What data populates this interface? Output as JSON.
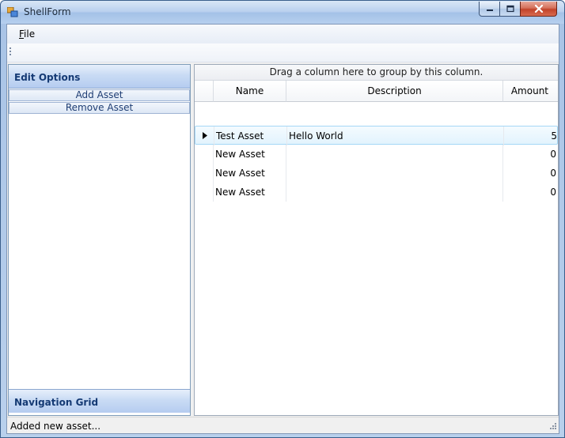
{
  "window": {
    "title": "ShellForm"
  },
  "menu": {
    "file_label_underlined": "F",
    "file_label_rest": "ile"
  },
  "left_panel": {
    "edit_options_header": "Edit Options",
    "add_asset_label": "Add Asset",
    "remove_asset_label": "Remove Asset",
    "navigation_grid_header": "Navigation Grid"
  },
  "grid": {
    "group_panel_text": "Drag a column here to group by this column.",
    "columns": [
      "Name",
      "Description",
      "Amount"
    ],
    "rows": [
      {
        "name": "Test Asset",
        "description": "Hello World",
        "amount": "5"
      },
      {
        "name": "New Asset",
        "description": "",
        "amount": "0"
      },
      {
        "name": "New Asset",
        "description": "",
        "amount": "0"
      },
      {
        "name": "New Asset",
        "description": "",
        "amount": "0"
      }
    ]
  },
  "status": {
    "text": "Added new asset..."
  },
  "colors": {
    "header_text": "#153a74",
    "selection_border": "#a5d7f6",
    "close_button": "#c2432a"
  },
  "icons": [
    "app-icon",
    "minimize-icon",
    "maximize-icon",
    "close-icon",
    "toolbar-grip-icon",
    "row-pointer-icon",
    "size-grip-icon"
  ]
}
